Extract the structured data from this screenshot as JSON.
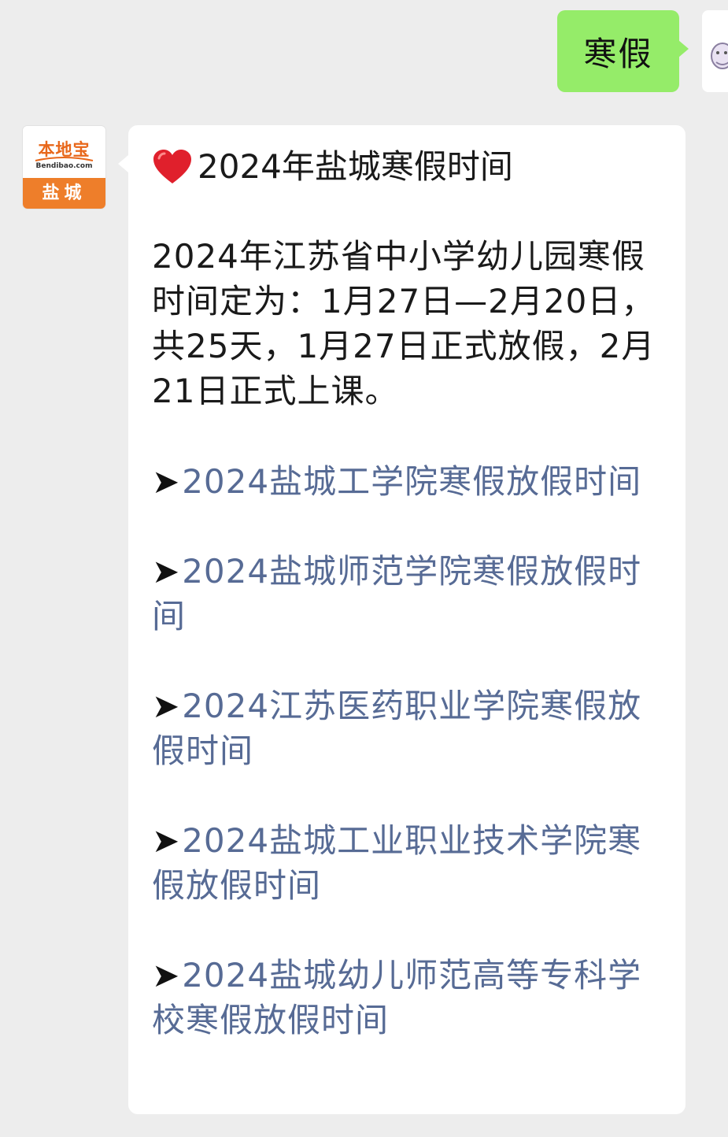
{
  "outgoing": {
    "text": "寒假"
  },
  "incoming": {
    "avatar": {
      "brand": "本地宝",
      "domain": "Bendibao.com",
      "city": "盐城"
    },
    "title_emoji": "heart-icon",
    "title": "2024年盐城寒假时间",
    "paragraph": "2024年江苏省中小学幼儿园寒假时间定为：1月27日—2月20日，共25天，1月27日正式放假，2月21日正式上课。",
    "arrow": "➤",
    "links": [
      "2024盐城工学院寒假放假时间",
      "2024盐城师范学院寒假放假时间",
      "2024江苏医药职业学院寒假放假时间",
      "2024盐城工业职业技术学院寒假放假时间",
      "2024盐城幼儿师范高等专科学校寒假放假时间"
    ]
  },
  "colors": {
    "background": "#ededed",
    "outgoing_bubble": "#95ec69",
    "incoming_bubble": "#ffffff",
    "link": "#576b95",
    "brand_orange": "#ee7e2a"
  }
}
